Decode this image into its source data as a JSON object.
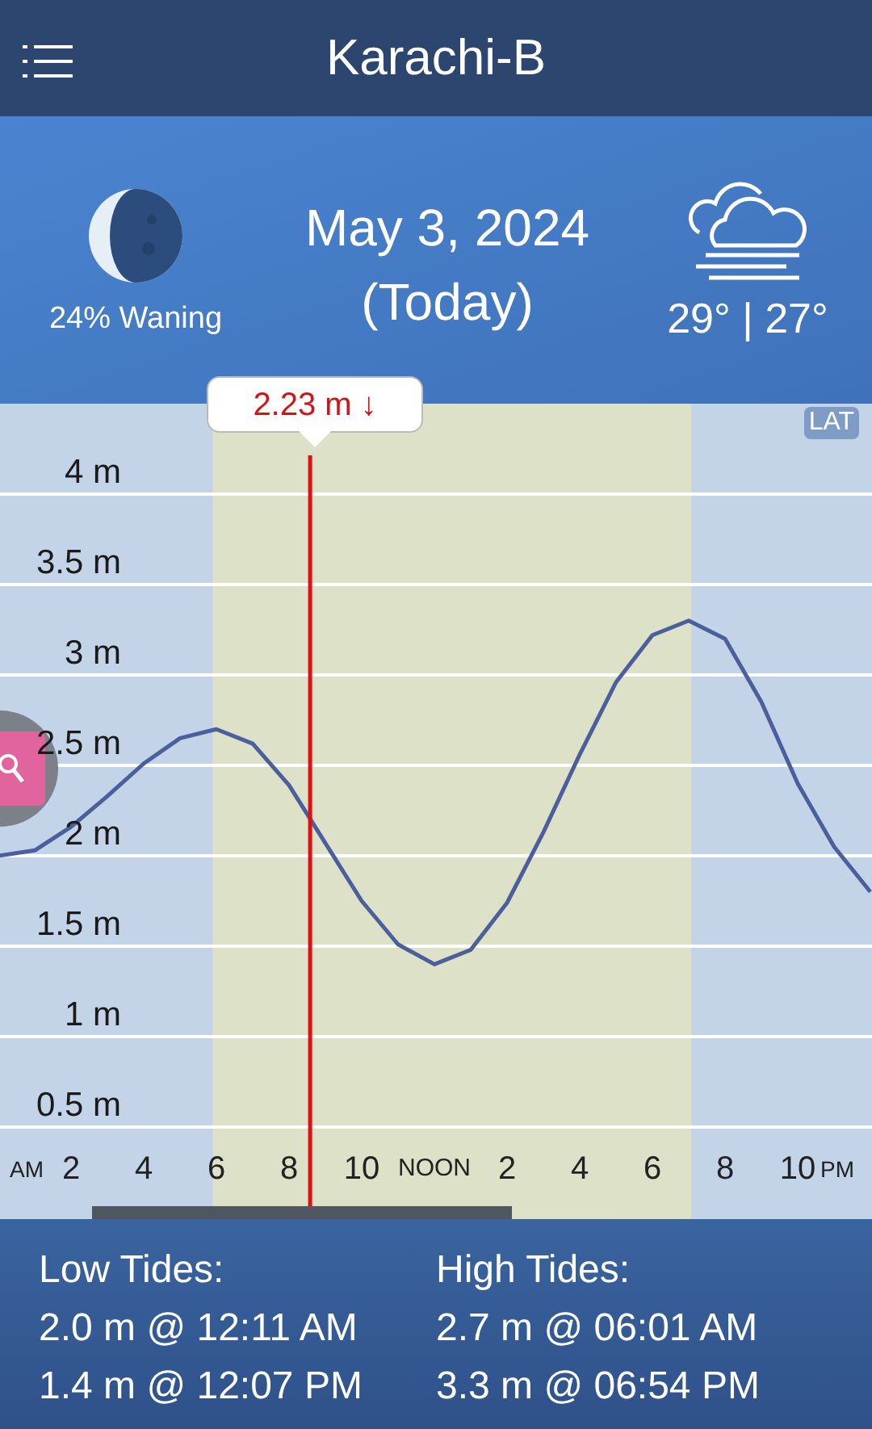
{
  "header": {
    "title": "Karachi-B"
  },
  "summary": {
    "moon_phase": "24% Waning",
    "date": "May 3, 2024",
    "date_note": "(Today)",
    "temperatures": "29° | 27°"
  },
  "chart": {
    "datum": "LAT",
    "am_label": "AM",
    "pm_label": "PM",
    "chart_data": {
      "type": "line",
      "categories": [
        null,
        null,
        "2",
        null,
        "4",
        null,
        "6",
        null,
        "8",
        null,
        "10",
        null,
        "NOON",
        null,
        "2",
        null,
        "4",
        null,
        "6",
        null,
        "8",
        null,
        "10",
        null,
        null
      ],
      "series": [
        {
          "color": "#4a5f9c",
          "values": [
            2.0,
            2.03,
            2.16,
            2.33,
            2.51,
            2.65,
            2.7,
            2.62,
            2.39,
            2.07,
            1.75,
            1.51,
            1.4,
            1.48,
            1.74,
            2.13,
            2.56,
            2.96,
            3.22,
            3.3,
            3.2,
            2.85,
            2.4,
            2.05,
            1.8
          ]
        }
      ],
      "ylim": [
        0,
        4.5
      ],
      "grid": true,
      "yticks": [
        {
          "value": 0.5,
          "label": "0.5 m"
        },
        {
          "value": 1,
          "label": "1 m"
        },
        {
          "value": 1.5,
          "label": "1.5 m"
        },
        {
          "value": 2,
          "label": "2 m"
        },
        {
          "value": 2.5,
          "label": "2.5 m"
        },
        {
          "value": 3,
          "label": "3 m"
        },
        {
          "value": 3.5,
          "label": "3.5 m"
        },
        {
          "value": 4,
          "label": "4 m"
        }
      ],
      "annotations": [
        "2.23 m ↓"
      ]
    }
  },
  "low_tides": {
    "title": "Low Tides:",
    "entries": [
      "2.0 m @ 12:11 AM",
      "1.4 m @ 12:07 PM"
    ]
  },
  "high_tides": {
    "title": "High Tides:",
    "entries": [
      "2.7 m @ 06:01 AM",
      "3.3 m @ 06:54 PM"
    ]
  }
}
